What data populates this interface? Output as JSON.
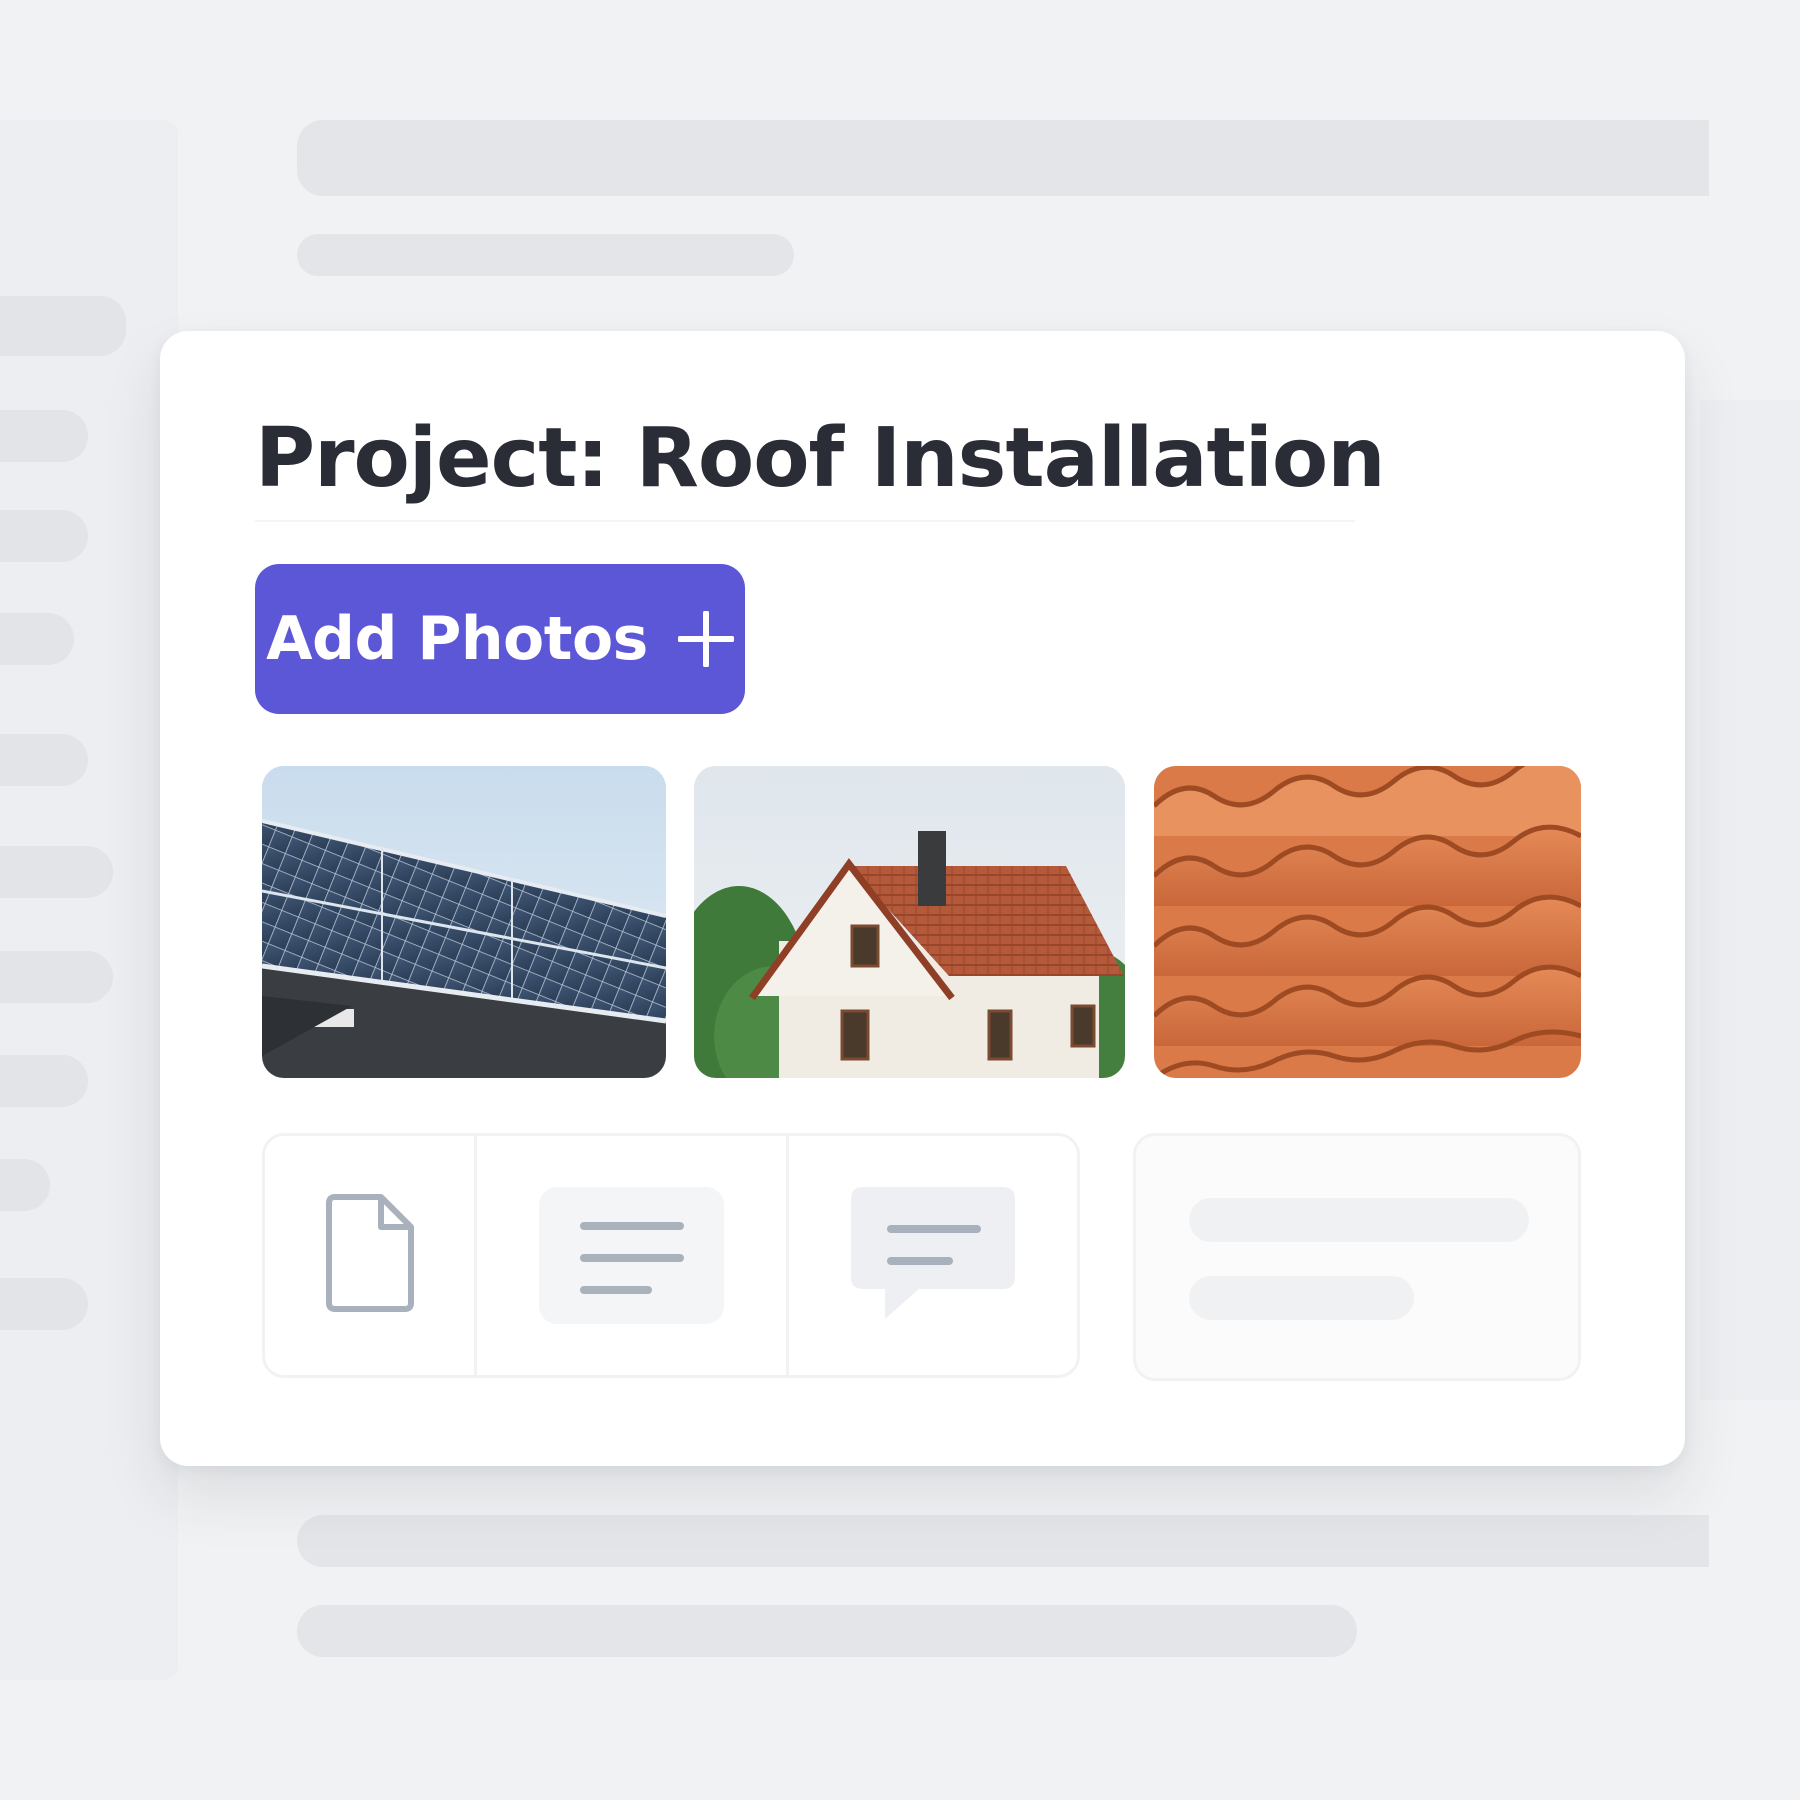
{
  "project": {
    "title": "Project: Roof Installation"
  },
  "toolbar": {
    "add_photos_label": "Add Photos",
    "add_photos_icon": "plus-icon"
  },
  "photos": [
    {
      "subject": "solar-panels"
    },
    {
      "subject": "house-with-tiled-roof"
    },
    {
      "subject": "terracotta-roof-tiles"
    }
  ],
  "tools": [
    {
      "icon": "document-icon"
    },
    {
      "icon": "text-lines-icon"
    },
    {
      "icon": "comment-icon"
    }
  ],
  "colors": {
    "accent": "#5b57d6",
    "title": "#2a2c36",
    "background": "#f1f2f4",
    "card": "#ffffff",
    "icon_stroke": "#a9b1bd"
  }
}
